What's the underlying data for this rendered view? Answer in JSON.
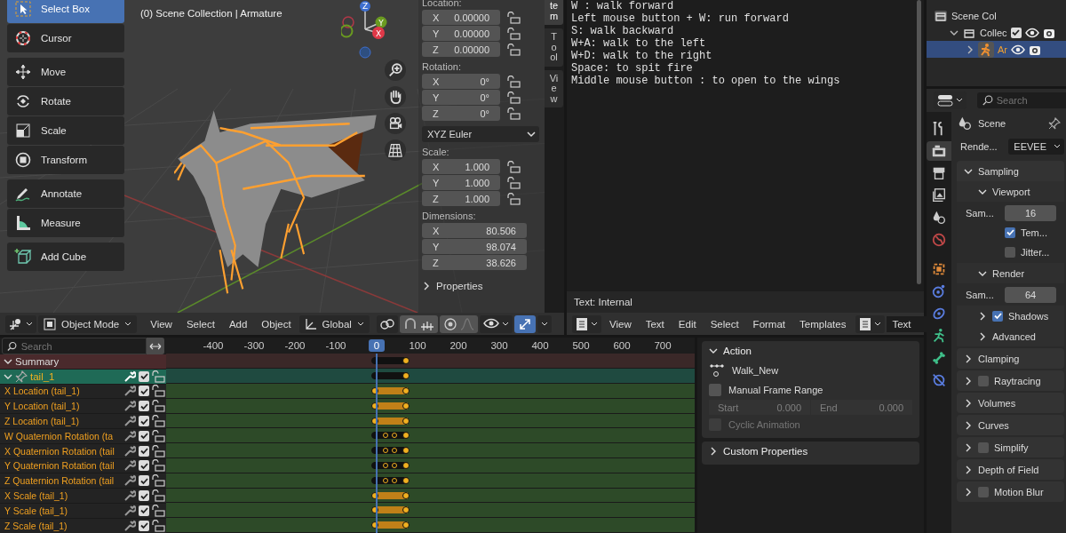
{
  "viewport": {
    "overlay_text": [
      "(0) Scene Collection | Armature"
    ],
    "tool_groups": [
      [
        {
          "label": "Select Box",
          "selected": true
        },
        {
          "label": "Cursor",
          "selected": false
        }
      ],
      [
        {
          "label": "Move",
          "selected": false
        },
        {
          "label": "Rotate",
          "selected": false
        },
        {
          "label": "Scale",
          "selected": false
        },
        {
          "label": "Transform",
          "selected": false
        }
      ],
      [
        {
          "label": "Annotate",
          "selected": false
        },
        {
          "label": "Measure",
          "selected": false
        }
      ],
      [
        {
          "label": "Add Cube",
          "selected": false
        }
      ]
    ],
    "gizmo": {
      "z": "Z",
      "y": "Y",
      "x": "X"
    },
    "sidebar": {
      "tabs": [
        {
          "label": "tem",
          "selected": true
        },
        {
          "label": "Tool",
          "selected": false
        },
        {
          "label": "View",
          "selected": false
        }
      ],
      "blocks": [
        {
          "kind": "vector",
          "title": "Location:",
          "fields": [
            {
              "axis": "X",
              "value": "0.00000",
              "locked": false
            },
            {
              "axis": "Y",
              "value": "0.00000",
              "locked": false
            },
            {
              "axis": "Z",
              "value": "0.00000",
              "locked": false
            }
          ]
        },
        {
          "kind": "vector",
          "title": "Rotation:",
          "fields": [
            {
              "axis": "X",
              "value": "0°",
              "locked": false
            },
            {
              "axis": "Y",
              "value": "0°",
              "locked": false
            },
            {
              "axis": "Z",
              "value": "0°",
              "locked": false
            }
          ]
        },
        {
          "kind": "dropdown",
          "value": "XYZ Euler"
        },
        {
          "kind": "vector",
          "title": "Scale:",
          "fields": [
            {
              "axis": "X",
              "value": "1.000",
              "locked": false
            },
            {
              "axis": "Y",
              "value": "1.000",
              "locked": false
            },
            {
              "axis": "Z",
              "value": "1.000",
              "locked": false
            }
          ]
        },
        {
          "kind": "vector",
          "title": "Dimensions:",
          "fields": [
            {
              "axis": "X",
              "value": "80.506"
            },
            {
              "axis": "Y",
              "value": "98.074"
            },
            {
              "axis": "Z",
              "value": "38.626"
            }
          ]
        }
      ],
      "collapsed_panel": "Properties"
    },
    "header": {
      "mode": "Object Mode",
      "menus": [
        "View",
        "Select",
        "Add",
        "Object"
      ],
      "orientation": "Global"
    }
  },
  "text_editor": {
    "lines": [
      "W : walk forward",
      "Left mouse button + W: run forward",
      "S: walk backward",
      "W+A: walk to the left",
      "W+D: walk to the right",
      "Space: to spit fire",
      "Middle mouse button : to open to the wings"
    ],
    "footer": "Text: Internal",
    "menus": [
      "View",
      "Text",
      "Edit",
      "Select",
      "Format",
      "Templates"
    ],
    "datablock": "Text"
  },
  "outliner": {
    "tree": [
      {
        "label": "Scene Col",
        "selected": false,
        "children": [
          {
            "label": "Collec",
            "selected": false,
            "expanded": true,
            "checked": true,
            "children": [
              {
                "label": "Ar",
                "selected": true,
                "expanded": false
              }
            ]
          }
        ]
      }
    ]
  },
  "properties": {
    "search_placeholder": "Search",
    "tabs": [
      {
        "selected": false
      },
      {
        "selected": true
      },
      {
        "selected": false
      },
      {
        "selected": false
      },
      {
        "selected": false
      },
      {
        "selected": false
      },
      {
        "selected": false
      },
      {
        "selected": false
      },
      {
        "selected": false
      },
      {
        "selected": false
      },
      {
        "selected": false
      },
      {
        "selected": false
      }
    ],
    "context": "Scene",
    "engine_label": "Rende...",
    "engine": "EEVEE",
    "panels": [
      {
        "title": "Sampling",
        "expanded": true,
        "subpanels": [
          {
            "title": "Viewport",
            "expanded": true,
            "rows": [
              {
                "kind": "number",
                "label": "Sam...",
                "value": "16"
              },
              {
                "kind": "check",
                "label": "Tem...",
                "checked": true
              },
              {
                "kind": "check",
                "label": "Jitter...",
                "checked": false
              }
            ]
          },
          {
            "title": "Render",
            "expanded": true,
            "rows": [
              {
                "kind": "number",
                "label": "Sam...",
                "value": "64"
              }
            ]
          },
          {
            "title": "Shadows",
            "expanded": false,
            "checked": true
          },
          {
            "title": "Advanced",
            "expanded": false
          }
        ]
      },
      {
        "title": "Clamping",
        "expanded": false
      },
      {
        "title": "Raytracing",
        "expanded": false,
        "checked": false
      },
      {
        "title": "Volumes",
        "expanded": false
      },
      {
        "title": "Curves",
        "expanded": false
      },
      {
        "title": "Simplify",
        "expanded": false,
        "checked": false
      },
      {
        "title": "Depth of Field",
        "expanded": false
      },
      {
        "title": "Motion Blur",
        "expanded": false,
        "checked": false
      }
    ]
  },
  "dopesheet": {
    "search_placeholder": "Search",
    "ticks": [
      "-400",
      "-300",
      "-200",
      "-100",
      "100",
      "200",
      "300",
      "400",
      "500",
      "600",
      "700"
    ],
    "current_frame": "0",
    "channels": [
      {
        "kind": "summary",
        "label": "Summary",
        "expanded": true
      },
      {
        "kind": "group",
        "label": "tail_1",
        "expanded": true,
        "checked": true,
        "locked": false
      },
      {
        "kind": "curve",
        "label": "X Location (tail_1)",
        "checked": true,
        "locked": false,
        "hold": true
      },
      {
        "kind": "curve",
        "label": "Y Location (tail_1)",
        "checked": true,
        "locked": false,
        "hold": true
      },
      {
        "kind": "curve",
        "label": "Z Location (tail_1)",
        "checked": true,
        "locked": false,
        "hold": true
      },
      {
        "kind": "curve",
        "label": "W Quaternion Rotation (ta",
        "checked": true,
        "locked": false,
        "hold": false
      },
      {
        "kind": "curve",
        "label": "X Quaternion Rotation (tail",
        "checked": true,
        "locked": false,
        "hold": false
      },
      {
        "kind": "curve",
        "label": "Y Quaternion Rotation (tail",
        "checked": true,
        "locked": false,
        "hold": false
      },
      {
        "kind": "curve",
        "label": "Z Quaternion Rotation (tail",
        "checked": true,
        "locked": false,
        "hold": false
      },
      {
        "kind": "curve",
        "label": "X Scale (tail_1)",
        "checked": true,
        "locked": false,
        "hold": true
      },
      {
        "kind": "curve",
        "label": "Y Scale (tail_1)",
        "checked": true,
        "locked": false,
        "hold": true
      },
      {
        "kind": "curve",
        "label": "Z Scale (tail_1)",
        "checked": true,
        "locked": false,
        "hold": true
      }
    ]
  },
  "action_panel": {
    "title": "Action",
    "expanded": true,
    "action_name": "Walk_New",
    "manual_label": "Manual Frame Range",
    "manual_frame_range": false,
    "start_label": "Start",
    "start": "0.000",
    "end_label": "End",
    "end": "0.000",
    "cyclic_label": "Cyclic Animation",
    "cyclic": false,
    "custom_properties": "Custom Properties"
  }
}
